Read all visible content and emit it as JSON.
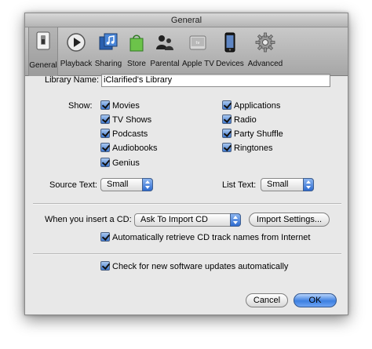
{
  "window": {
    "title": "General"
  },
  "toolbar": {
    "items": [
      {
        "label": "General",
        "icon": "general-switch-icon",
        "selected": true
      },
      {
        "label": "Playback",
        "icon": "play-icon"
      },
      {
        "label": "Sharing",
        "icon": "sharing-music-icon"
      },
      {
        "label": "Store",
        "icon": "store-bag-icon"
      },
      {
        "label": "Parental",
        "icon": "parental-people-icon"
      },
      {
        "label": "Apple TV",
        "icon": "apple-tv-icon"
      },
      {
        "label": "Devices",
        "icon": "iphone-icon"
      },
      {
        "label": "Advanced",
        "icon": "gear-icon"
      }
    ]
  },
  "library": {
    "label": "Library Name:",
    "value": "iClarified's Library"
  },
  "show": {
    "label": "Show:",
    "left": [
      {
        "label": "Movies",
        "checked": true
      },
      {
        "label": "TV Shows",
        "checked": true
      },
      {
        "label": "Podcasts",
        "checked": true
      },
      {
        "label": "Audiobooks",
        "checked": true
      },
      {
        "label": "Genius",
        "checked": true
      }
    ],
    "right": [
      {
        "label": "Applications",
        "checked": true
      },
      {
        "label": "Radio",
        "checked": true
      },
      {
        "label": "Party Shuffle",
        "checked": true
      },
      {
        "label": "Ringtones",
        "checked": true
      }
    ]
  },
  "source_text": {
    "label": "Source Text:",
    "value": "Small"
  },
  "list_text": {
    "label": "List Text:",
    "value": "Small"
  },
  "cd": {
    "label": "When you insert a CD:",
    "value": "Ask To Import CD",
    "import_settings_label": "Import Settings...",
    "auto_retrieve_label": "Automatically retrieve CD track names from Internet",
    "auto_retrieve_checked": true
  },
  "updates": {
    "label": "Check for new software updates automatically",
    "checked": true
  },
  "buttons": {
    "cancel": "Cancel",
    "ok": "OK"
  },
  "colors": {
    "accent": "#3d7fe0",
    "toolbar": "#b4b4b4",
    "window": "#e8e8e8"
  }
}
